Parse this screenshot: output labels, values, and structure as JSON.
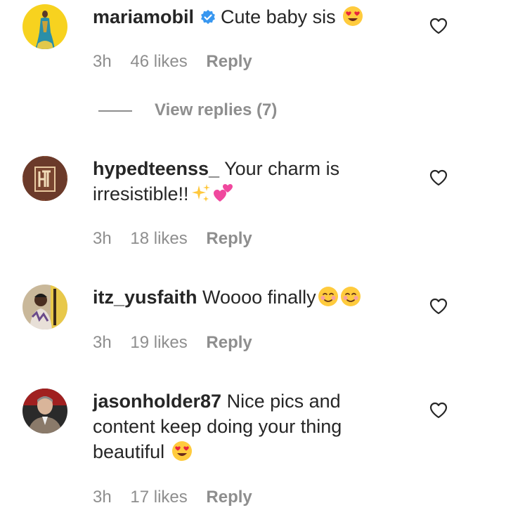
{
  "comments": [
    {
      "username": "mariamobil",
      "verified": true,
      "text": "Cute baby sis",
      "emojis": [
        "heart-eyes-emoji"
      ],
      "time": "3h",
      "likes": "46 likes",
      "reply": "Reply",
      "view_replies": "View replies (7)"
    },
    {
      "username": "hypedteenss_",
      "verified": false,
      "text": "Your charm is irresistible!!",
      "emojis": [
        "sparkles-emoji",
        "two-hearts-emoji"
      ],
      "time": "3h",
      "likes": "18 likes",
      "reply": "Reply"
    },
    {
      "username": "itz_yusfaith",
      "verified": false,
      "text": "Woooo finally",
      "emojis": [
        "smiling-face-emoji",
        "smiling-face-emoji"
      ],
      "time": "3h",
      "likes": "19 likes",
      "reply": "Reply"
    },
    {
      "username": "jasonholder87",
      "verified": false,
      "text": "Nice pics and content keep doing your thing beautiful",
      "emojis": [
        "heart-eyes-emoji"
      ],
      "time": "3h",
      "likes": "17 likes",
      "reply": "Reply"
    }
  ],
  "colors": {
    "text": "#262626",
    "muted": "#8e8e8e",
    "verified_blue": "#3897f0",
    "avatar1_bg": "#f7d21f",
    "avatar2_bg": "#6b3a2a"
  }
}
